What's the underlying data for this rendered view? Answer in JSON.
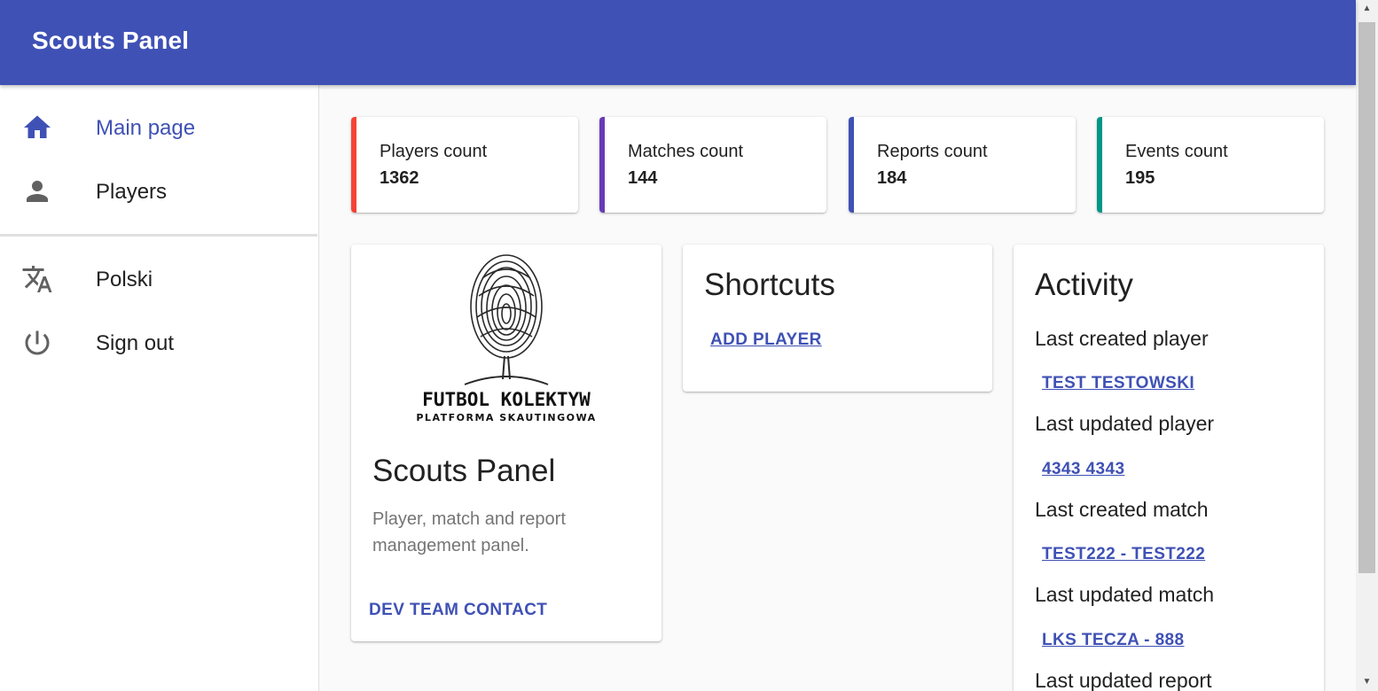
{
  "app": {
    "title": "Scouts Panel"
  },
  "sidebar": {
    "items": [
      {
        "label": "Main page",
        "icon": "home-icon"
      },
      {
        "label": "Players",
        "icon": "person-icon"
      }
    ],
    "secondary": [
      {
        "label": "Polski",
        "icon": "translate-icon"
      },
      {
        "label": "Sign out",
        "icon": "power-icon"
      }
    ]
  },
  "stats": [
    {
      "label": "Players count",
      "value": "1362",
      "color": "#f44336"
    },
    {
      "label": "Matches count",
      "value": "144",
      "color": "#673ab7"
    },
    {
      "label": "Reports count",
      "value": "184",
      "color": "#3f51b5"
    },
    {
      "label": "Events count",
      "value": "195",
      "color": "#009688"
    }
  ],
  "about": {
    "logo_text": "FUTBOL KOLEKTYW",
    "logo_subtext": "PLATFORMA SKAUTINGOWA",
    "title": "Scouts Panel",
    "description": "Player, match and report management panel.",
    "contact_label": "DEV TEAM CONTACT"
  },
  "shortcuts": {
    "title": "Shortcuts",
    "add_player": "ADD PLAYER"
  },
  "activity": {
    "title": "Activity",
    "items": [
      {
        "label": "Last created player",
        "link": "TEST TESTOWSKI"
      },
      {
        "label": "Last updated player",
        "link": "4343 4343"
      },
      {
        "label": "Last created match",
        "link": "TEST222 - TEST222"
      },
      {
        "label": "Last updated match",
        "link": "LKS TECZA - 888"
      },
      {
        "label": "Last updated report",
        "link": ""
      }
    ]
  },
  "colors": {
    "primary": "#3f51b5",
    "icon": "#616161"
  }
}
